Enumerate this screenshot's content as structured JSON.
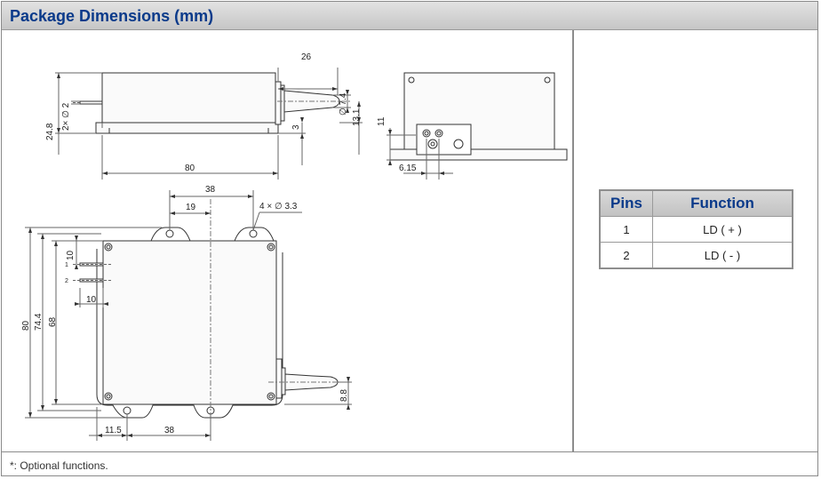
{
  "header": {
    "title": "Package Dimensions (mm)"
  },
  "drawing": {
    "side_view": {
      "dim_length": "26",
      "dim_fiber_dia": "∅ 7.4",
      "dim_height": "24.8",
      "dim_pin_dia": "2× ∅ 2",
      "dim_13_1": "13.1",
      "dim_3": "3",
      "dim_80": "80"
    },
    "end_view": {
      "dim_11": "11",
      "dim_6_15": "6.15"
    },
    "top_view": {
      "dim_38_top": "38",
      "dim_19": "19",
      "dim_holes": "4 × ∅ 3.3",
      "dim_10_vert": "10",
      "pin1": "1",
      "pin2": "2",
      "dim_10_horiz": "10",
      "dim_80": "80",
      "dim_74_4": "74.4",
      "dim_68": "68",
      "dim_8_8": "8.8",
      "dim_11_5": "11.5",
      "dim_38_bottom": "38"
    }
  },
  "pins_table": {
    "headers": [
      "Pins",
      "Function"
    ],
    "rows": [
      {
        "pin": "1",
        "function": "LD ( + )"
      },
      {
        "pin": "2",
        "function": "LD ( - )"
      }
    ]
  },
  "footnote": "*: Optional functions."
}
